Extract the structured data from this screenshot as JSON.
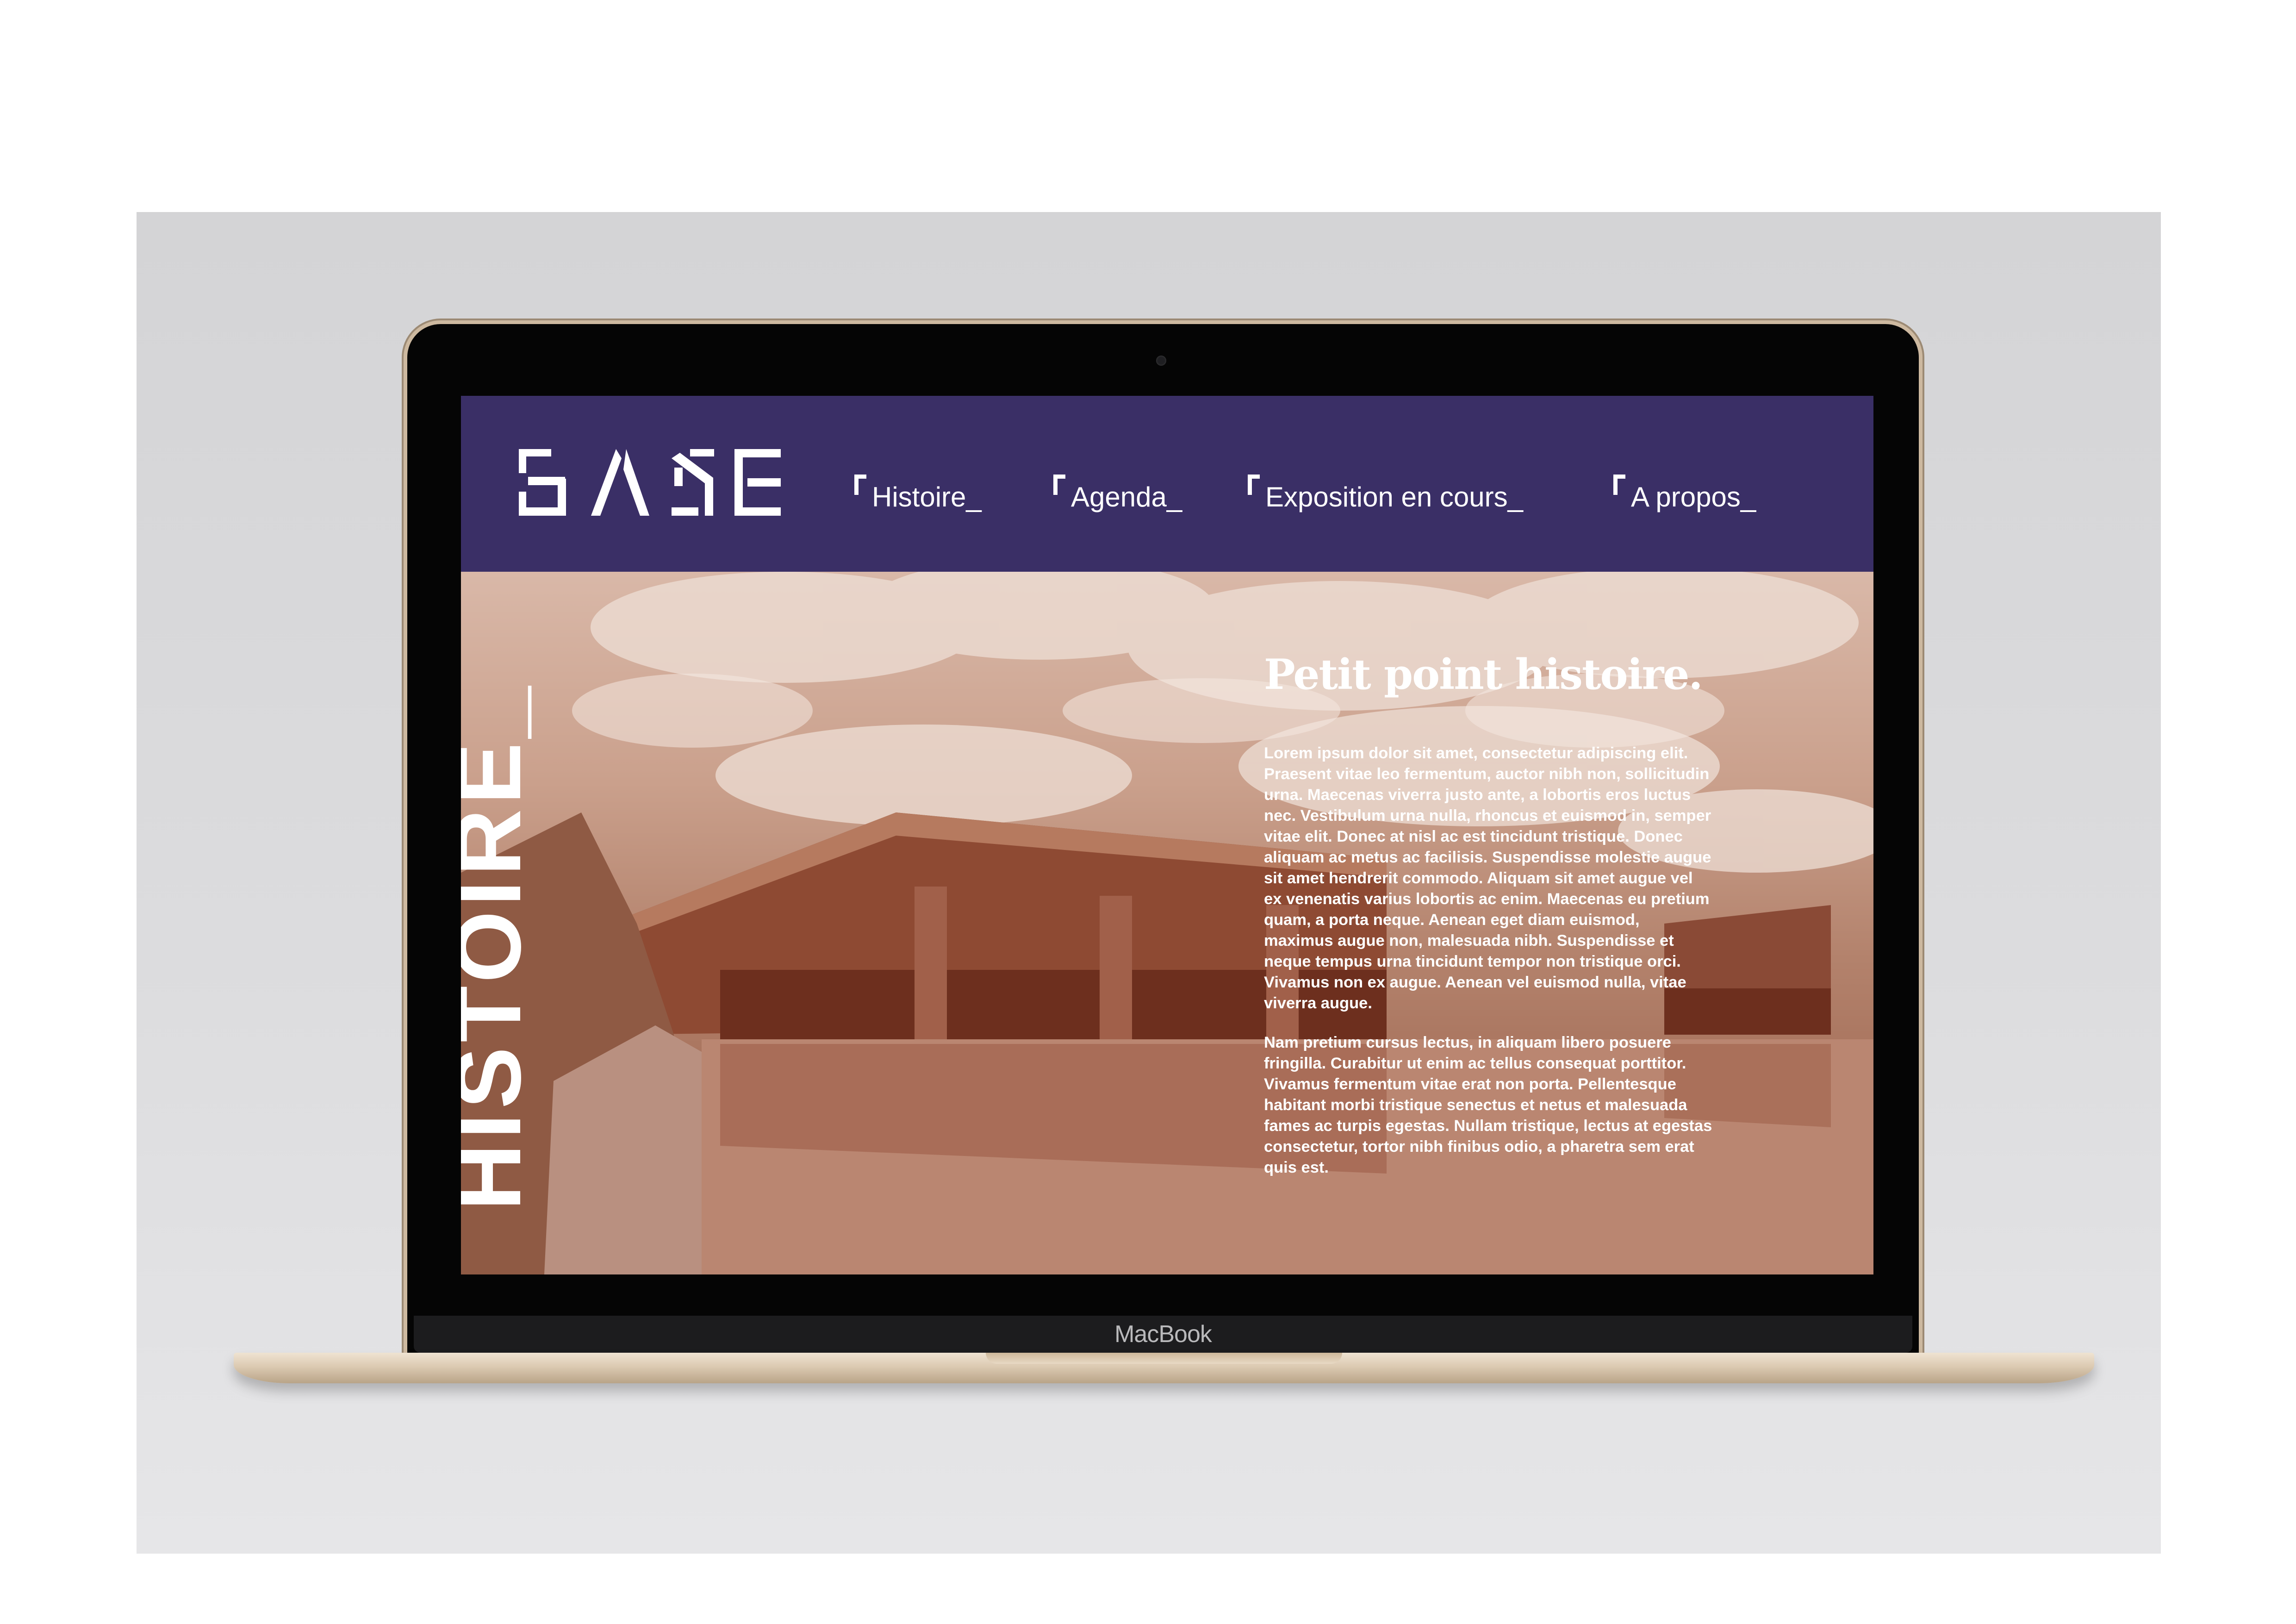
{
  "device": {
    "chin_label": "MacBook"
  },
  "header": {
    "logo_text": "BASE",
    "nav": [
      {
        "label": "Histoire_"
      },
      {
        "label": "Agenda_"
      },
      {
        "label": "Exposition en cours_"
      },
      {
        "label": "A propos_"
      }
    ]
  },
  "hero": {
    "vertical_title": "HISTOIRE_",
    "article_title": "Petit point histoire.",
    "paragraphs": [
      "Lorem ipsum dolor sit amet, consectetur adipiscing elit. Praesent vitae leo fermentum, auctor nibh non, sollicitudin urna. Maecenas viverra justo ante, a lobortis eros luctus nec. Vestibulum urna nulla, rhoncus et euismod in, semper vitae elit. Donec at nisl ac est tincidunt tristique. Donec aliquam ac metus ac facilisis. Suspendisse molestie augue sit amet hendrerit commodo. Aliquam sit amet augue vel ex venenatis varius lobortis ac enim. Maecenas eu pretium quam, a porta neque. Aenean eget diam euismod, maximus augue non, malesuada nibh. Suspendisse et neque tempus urna tincidunt tempor non tristique orci. Vivamus non ex augue. Aenean vel euismod nulla, vitae viverra augue.",
      "Nam pretium cursus lectus, in aliquam libero posuere fringilla. Curabitur ut enim ac tellus consequat porttitor. Vivamus fermentum vitae erat non porta. Pellentesque habitant morbi tristique senectus et netus et malesuada fames ac turpis egestas. Nullam tristique, lectus at egestas consectetur, tortor nibh finibus odio, a pharetra sem erat quis est."
    ]
  },
  "colors": {
    "header_bg": "#3a2f66",
    "photo_tint": "#a6705a",
    "text": "#ffffff"
  }
}
